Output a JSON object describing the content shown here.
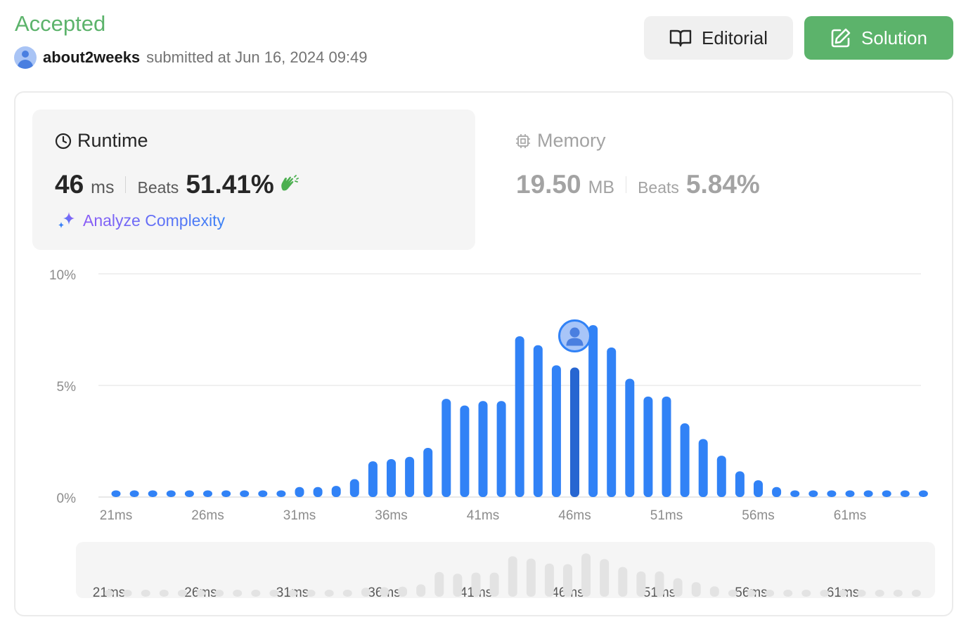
{
  "header": {
    "status": "Accepted",
    "username": "about2weeks",
    "submitted_text": "submitted at Jun 16, 2024 09:49"
  },
  "buttons": {
    "editorial_label": "Editorial",
    "solution_label": "Solution"
  },
  "runtime": {
    "title": "Runtime",
    "value": "46",
    "unit": "ms",
    "beats_label": "Beats",
    "beats_value": "51.41%",
    "analyze_label": "Analyze Complexity"
  },
  "memory": {
    "title": "Memory",
    "value": "19.50",
    "unit": "MB",
    "beats_label": "Beats",
    "beats_value": "5.84%"
  },
  "colors": {
    "accepted": "#5cb36b",
    "bar": "#3182f6",
    "bar_user": "#2766d1",
    "minimap_bar": "#e3e3e3"
  },
  "chart_data": {
    "type": "bar",
    "x": [
      21,
      22,
      23,
      24,
      25,
      26,
      27,
      28,
      29,
      30,
      31,
      32,
      33,
      34,
      35,
      36,
      37,
      38,
      39,
      40,
      41,
      42,
      43,
      44,
      45,
      46,
      47,
      48,
      49,
      50,
      51,
      52,
      53,
      54,
      55,
      56,
      57,
      58,
      59,
      60,
      61,
      62,
      63,
      64,
      65
    ],
    "values": [
      0.3,
      0.3,
      0.3,
      0.3,
      0.3,
      0.3,
      0.3,
      0.3,
      0.3,
      0.3,
      0.45,
      0.45,
      0.5,
      0.8,
      1.6,
      1.7,
      1.8,
      2.2,
      4.4,
      4.1,
      4.3,
      4.3,
      7.2,
      6.8,
      5.9,
      5.8,
      7.7,
      6.7,
      5.3,
      4.5,
      4.5,
      3.3,
      2.6,
      1.85,
      1.15,
      0.75,
      0.45,
      0.3,
      0.3,
      0.3,
      0.3,
      0.3,
      0.3,
      0.3,
      0.3
    ],
    "highlight_x": 46,
    "ylim": [
      0,
      10
    ],
    "y_ticks": [
      "0%",
      "5%",
      "10%"
    ],
    "x_ticks": [
      "21ms",
      "26ms",
      "31ms",
      "36ms",
      "41ms",
      "46ms",
      "51ms",
      "56ms",
      "61ms"
    ],
    "grid": true
  }
}
